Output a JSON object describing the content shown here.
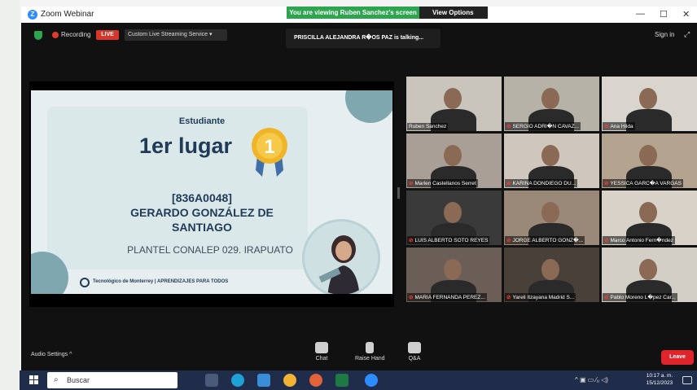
{
  "window": {
    "app_title": "Zoom Webinar",
    "viewing_banner": "You are viewing Ruben Sanchez's screen",
    "view_options": "View Options",
    "controls": {
      "minimize": "—",
      "maximize": "☐",
      "close": "✕"
    }
  },
  "topbar": {
    "recording": "Recording",
    "live": "LIVE",
    "streaming": "Custom Live Streaming Service ▾",
    "talking": "PRISCILLA ALEJANDRA R�OS PAZ is talking...",
    "signin": "Sign in"
  },
  "slide": {
    "student": "Estudiante",
    "place": "1er lugar",
    "medal_number": "1",
    "code": "[836A0048]",
    "name_line1": "GERARDO GONZÁLEZ DE",
    "name_line2": "SANTIAGO",
    "plantel": "PLANTEL CONALEP 029. IRAPUATO",
    "logo_text": "Tecnológico de Monterrey | APRENDIZAJES PARA TODOS"
  },
  "participants": [
    {
      "name": "Ruben Sanchez",
      "muted": false,
      "bg": "#c9c5bd"
    },
    {
      "name": "SERGIO ADRI�N CAVAZ...",
      "muted": true,
      "bg": "#b7b2a8"
    },
    {
      "name": "Ana Hilda",
      "muted": true,
      "bg": "#d9d4cd"
    },
    {
      "name": "Marlen Castellanos Serret",
      "muted": true,
      "bg": "#a99f97"
    },
    {
      "name": "KARINA DONDIEGO DU...",
      "muted": true,
      "bg": "#cfc7bd"
    },
    {
      "name": "YESSICA GARC�A VARGAS",
      "muted": true,
      "bg": "#b4a38f"
    },
    {
      "name": "LUIS ALBERTO SOTO REYES",
      "muted": true,
      "bg": "#3a3a3a"
    },
    {
      "name": "JORGE ALBERTO GONZ�...",
      "muted": true,
      "bg": "#9a8878"
    },
    {
      "name": "Marco Antonio Fern�ndez",
      "muted": true,
      "bg": "#d8d2c8"
    },
    {
      "name": "MARIA FERNANDA PEREZ...",
      "muted": true,
      "bg": "#6b5e57"
    },
    {
      "name": "Yareli Itzayana Madrid S...",
      "muted": true,
      "bg": "#4a403a"
    },
    {
      "name": "Pablo Moreno L�pez Car...",
      "muted": true,
      "bg": "#d4cfc6"
    }
  ],
  "bottombar": {
    "audio_settings": "Audio Settings ^",
    "chat": "Chat",
    "raise_hand": "Raise Hand",
    "qa": "Q&A",
    "leave": "Leave"
  },
  "taskbar": {
    "search": "Buscar",
    "time": "10:17 a. m.",
    "date": "15/12/2023",
    "tray": "^ ▣ ▭ ⁄ᵤ ◁)"
  },
  "colors": {
    "accent_green": "#2da44e",
    "live_red": "#d7362b",
    "leave_red": "#e0242c",
    "zoom_blue": "#2d8cff"
  }
}
